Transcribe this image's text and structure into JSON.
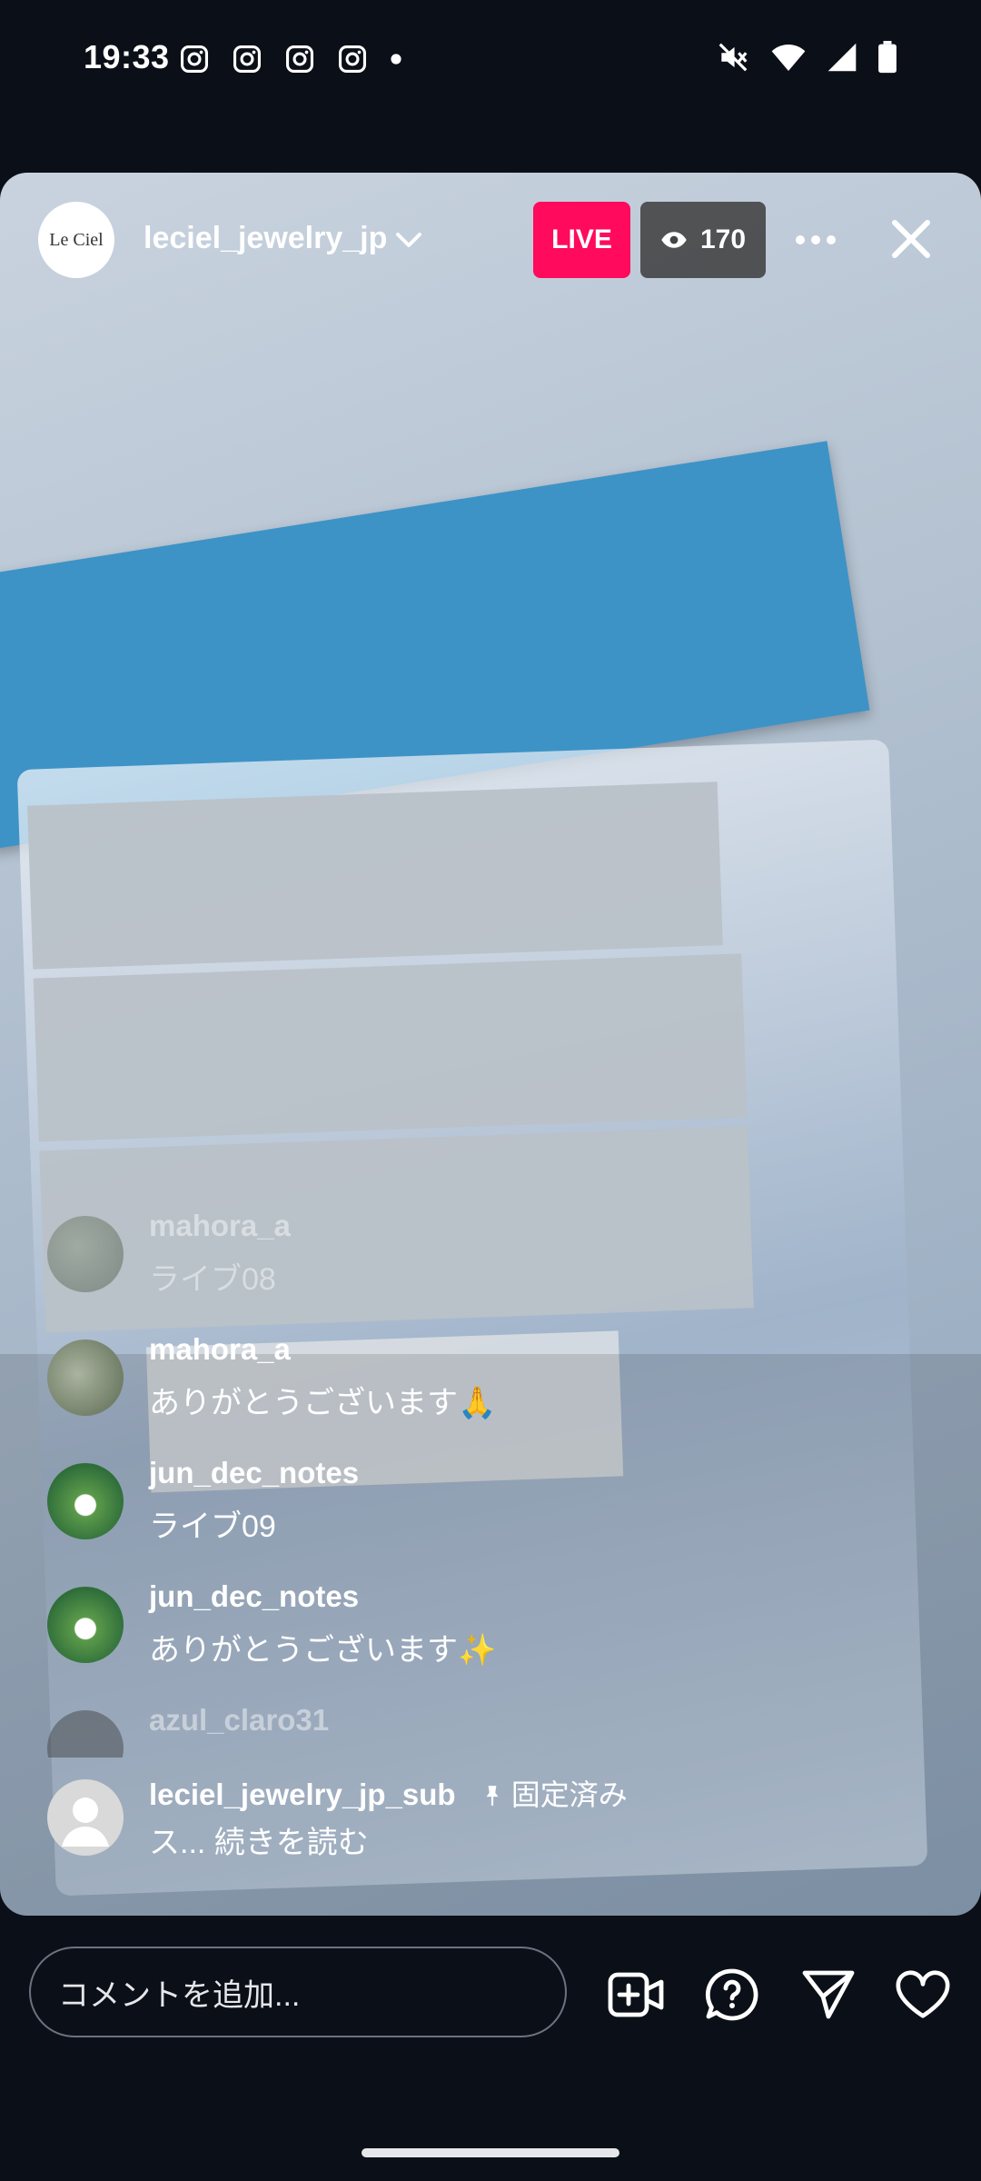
{
  "status_bar": {
    "time": "19:33",
    "notification_icons": [
      "instagram-icon",
      "instagram-icon",
      "instagram-icon",
      "instagram-icon",
      "dot-icon"
    ],
    "right_icons": [
      "mute-icon",
      "wifi-icon",
      "signal-icon",
      "battery-icon"
    ]
  },
  "header": {
    "avatar_text": "Le Ciel",
    "username": "leciel_jewelry_jp",
    "live_label": "LIVE",
    "viewer_count": "170",
    "live_color": "#ff0a5c"
  },
  "comments": [
    {
      "user": "mahora_a",
      "text": "ライブ08",
      "faded": true
    },
    {
      "user": "mahora_a",
      "text": "ありがとうございます🙏",
      "faded": false
    },
    {
      "user": "jun_dec_notes",
      "text": "ライブ09",
      "faded": false
    },
    {
      "user": "jun_dec_notes",
      "text": "ありがとうございます✨",
      "faded": false
    },
    {
      "user": "azul_claro31",
      "text": "",
      "faded": true
    },
    {
      "user": "leciel_jewelry_jp_sub",
      "pinned_label": "固定済み",
      "text": "ス... 続きを読む",
      "faded": false
    }
  ],
  "bottom_bar": {
    "comment_placeholder": "コメントを追加...",
    "icons": [
      "add-video-icon",
      "question-icon",
      "send-icon",
      "heart-icon"
    ]
  }
}
